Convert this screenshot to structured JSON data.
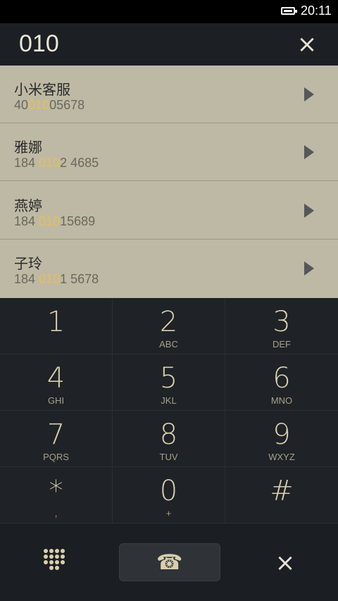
{
  "status_bar": {
    "time": "20:11",
    "battery_icon": "battery-icon"
  },
  "dial_input": {
    "value": "010",
    "clear_icon": "close-icon"
  },
  "contacts": [
    {
      "name": "小米客服",
      "number_pre": "40",
      "number_match": "010",
      "number_post": "05678"
    },
    {
      "name": "雅娜",
      "number_pre": "184 ",
      "number_match": "010",
      "number_post": "2 4685"
    },
    {
      "name": "燕婷",
      "number_pre": "184 ",
      "number_match": "010",
      "number_post": "15689"
    },
    {
      "name": "子玲",
      "number_pre": "184 ",
      "number_match": "010",
      "number_post": "1 5678"
    }
  ],
  "keypad": [
    {
      "digit": "1",
      "letters": ""
    },
    {
      "digit": "2",
      "letters": "ABC"
    },
    {
      "digit": "3",
      "letters": "DEF"
    },
    {
      "digit": "4",
      "letters": "GHI"
    },
    {
      "digit": "5",
      "letters": "JKL"
    },
    {
      "digit": "6",
      "letters": "MNO"
    },
    {
      "digit": "7",
      "letters": "PQRS"
    },
    {
      "digit": "8",
      "letters": "TUV"
    },
    {
      "digit": "9",
      "letters": "WXYZ"
    },
    {
      "digit": "*",
      "letters": ","
    },
    {
      "digit": "0",
      "letters": "+"
    },
    {
      "digit": "#",
      "letters": ""
    }
  ],
  "action_bar": {
    "keypad_icon": "dialpad-icon",
    "call_icon": "phone-icon",
    "delete_icon": "close-icon"
  },
  "colors": {
    "highlight": "#e6bf59",
    "contact_bg": "#bdb9a4",
    "keypad_bg": "#1f2226",
    "key_text": "#d8cfad"
  }
}
